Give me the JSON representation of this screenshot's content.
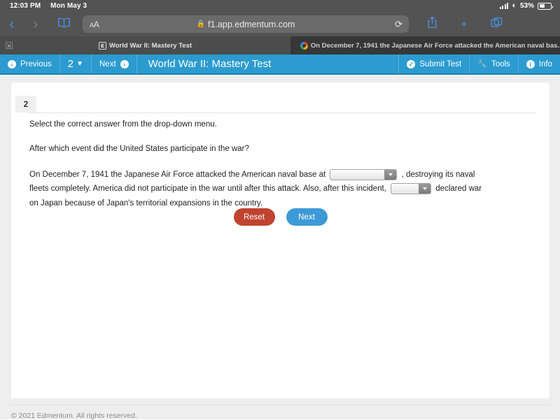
{
  "status_bar": {
    "time": "12:03 PM",
    "date": "Mon May 3",
    "battery_percent": "53%",
    "signal_icon": "cellular-signal-icon",
    "wifi_icon": "wifi-icon",
    "battery_icon": "battery-icon"
  },
  "browser": {
    "back_icon": "chevron-left-icon",
    "forward_icon": "chevron-right-icon",
    "bookmarks_icon": "book-icon",
    "text_size_label": "AA",
    "lock_icon": "lock-icon",
    "url": "f1.app.edmentum.com",
    "reload_icon": "reload-icon",
    "share_icon": "share-icon",
    "new_tab_icon": "plus-icon",
    "tab_overview_icon": "tabs-icon",
    "tabs": [
      {
        "title": "World War II: Mastery Test",
        "favicon": "edmentum-e-favicon",
        "active": true,
        "close_icon": "close-icon"
      },
      {
        "title": "On December 7, 1941 the Japanese Air Force attacked the American naval bas...",
        "favicon": "google-g-favicon",
        "active": false
      }
    ]
  },
  "app_toolbar": {
    "previous_label": "Previous",
    "previous_icon": "arrow-left-circle-icon",
    "page_number": "2",
    "page_chevron_icon": "chevron-down-icon",
    "next_label": "Next",
    "next_icon": "arrow-right-circle-icon",
    "title": "World War II: Mastery Test",
    "submit_label": "Submit Test",
    "submit_icon": "check-circle-icon",
    "tools_label": "Tools",
    "tools_icon": "wrench-icon",
    "info_label": "Info",
    "info_icon": "info-circle-icon",
    "accent_color": "#2b9bd0"
  },
  "question": {
    "number": "2",
    "instruction": "Select the correct answer from the drop-down menu.",
    "prompt": "After which event did the United States participate in the war?",
    "paragraph": {
      "part1": "On December 7, 1941 the Japanese Air Force attacked the American naval base at",
      "part2": ", destroying its naval fleets completely. America did not participate in the war until after this attack. Also, after this incident,",
      "part3": "declared war on Japan because of Japan's territorial expansions in the country."
    },
    "dropdown1": {
      "value": "",
      "name": "naval-base-dropdown"
    },
    "dropdown2": {
      "value": "",
      "name": "country-dropdown"
    },
    "reset_label": "Reset",
    "next_label": "Next",
    "reset_color": "#c0432e",
    "next_color": "#3d9ad6"
  },
  "footer": {
    "copyright": "© 2021 Edmentum. All rights reserved."
  }
}
